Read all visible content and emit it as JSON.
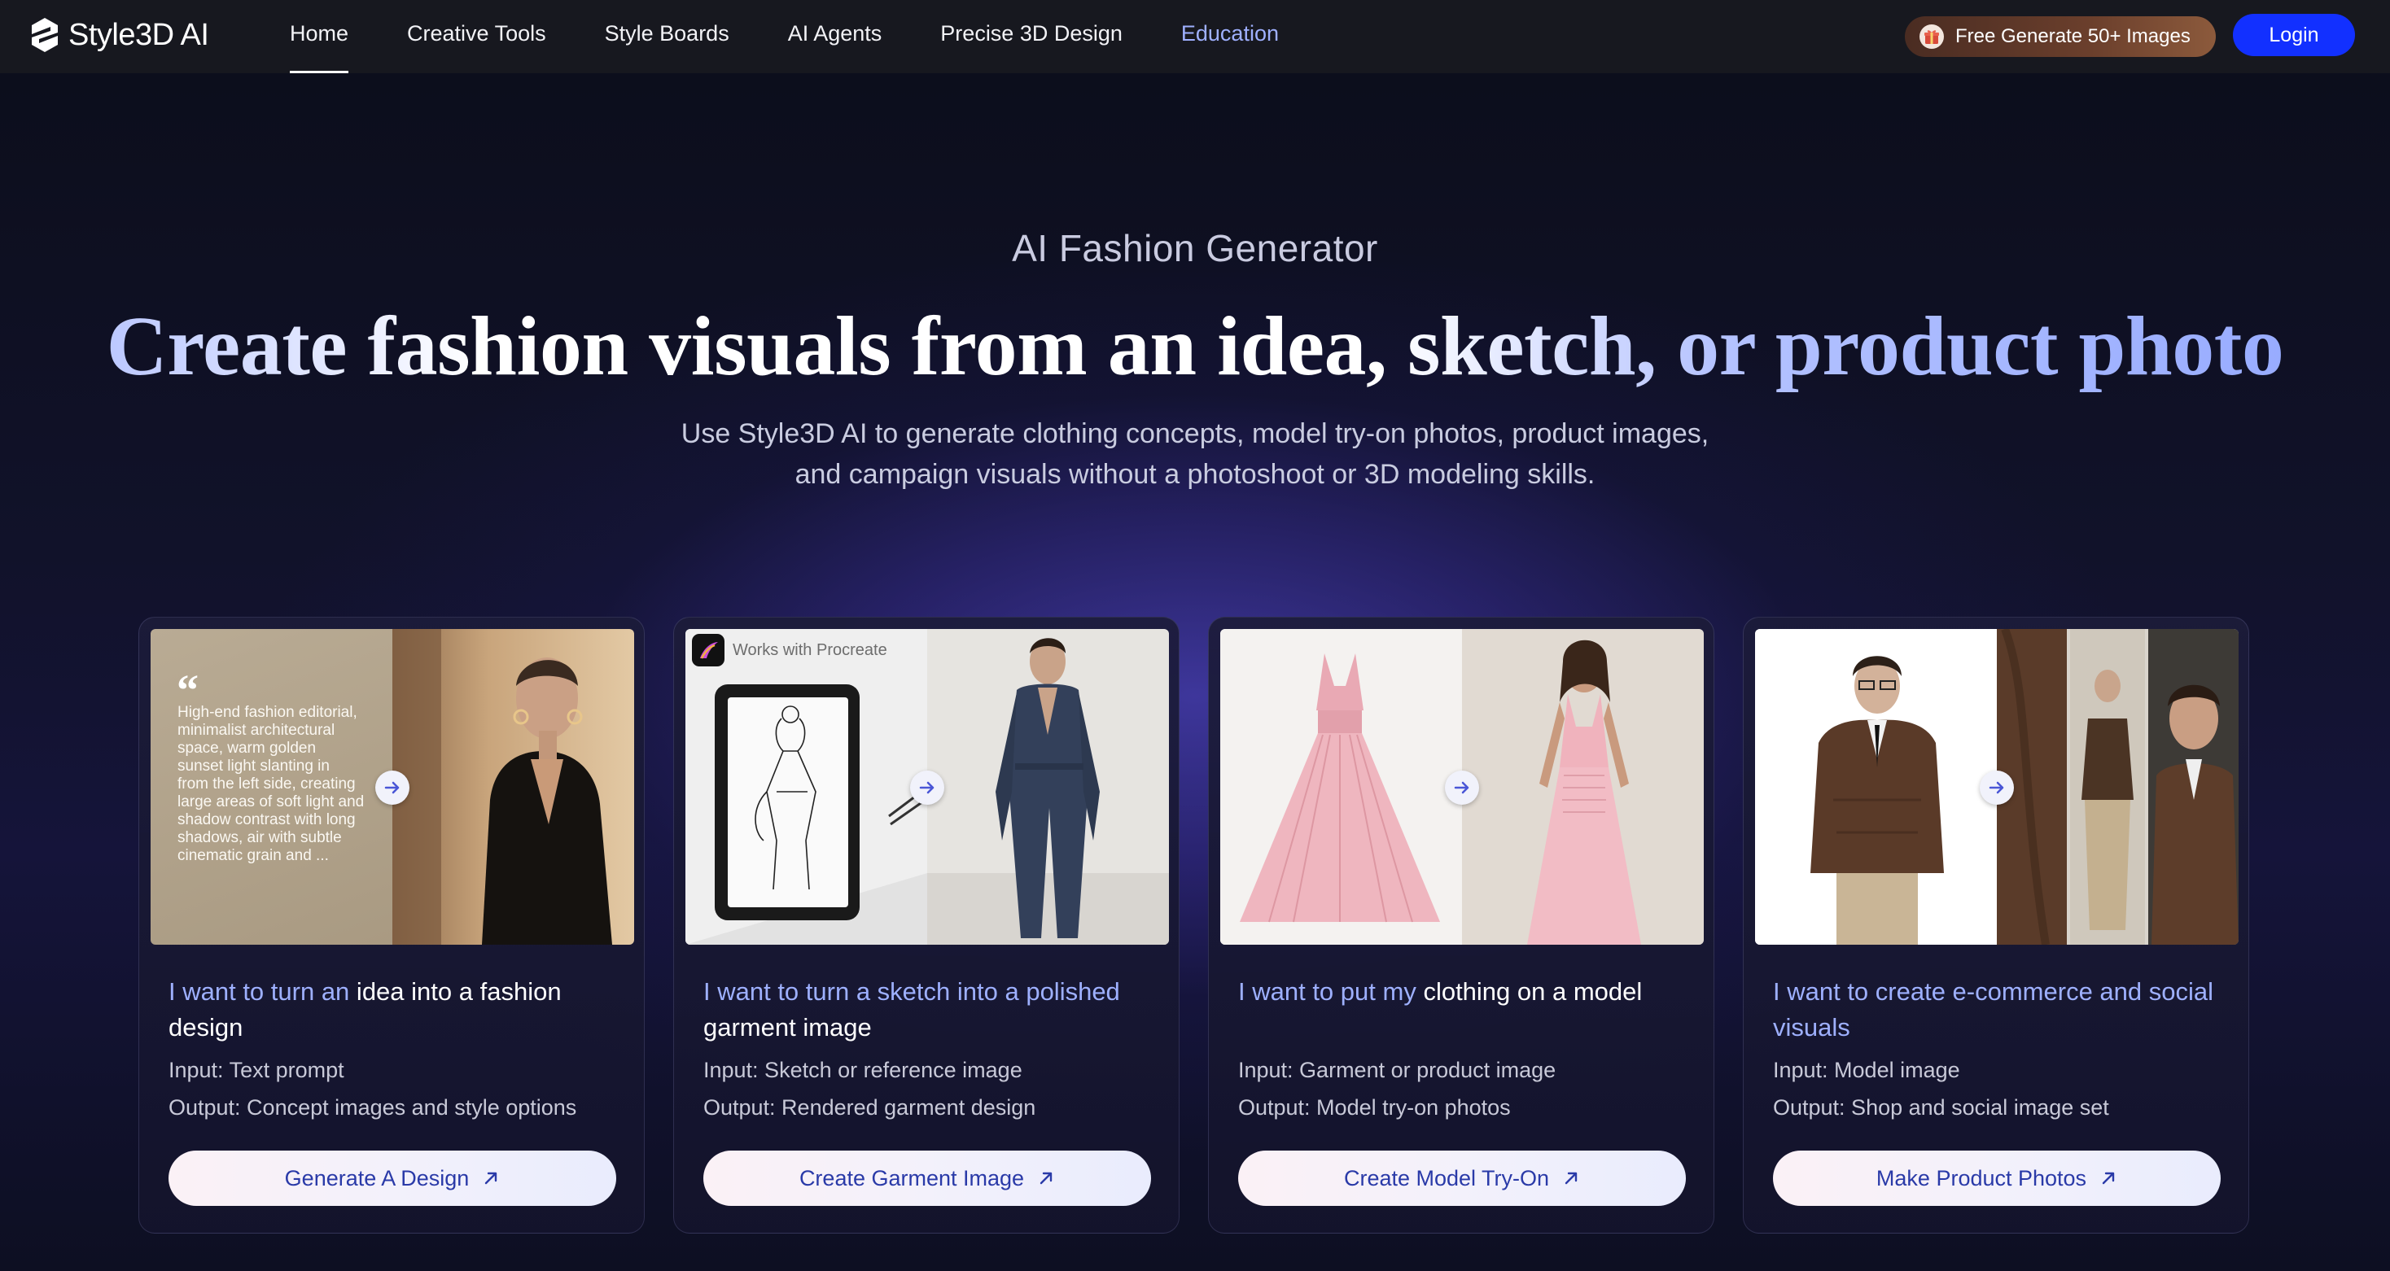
{
  "nav": {
    "brand": "Style3D AI",
    "items": [
      {
        "label": "Home"
      },
      {
        "label": "Creative Tools"
      },
      {
        "label": "Style Boards"
      },
      {
        "label": "AI Agents"
      },
      {
        "label": "Precise 3D Design"
      },
      {
        "label": "Education"
      }
    ],
    "promo": "Free Generate 50+ Images",
    "login": "Login"
  },
  "hero": {
    "eyebrow": "AI Fashion Generator",
    "headline": "Create fashion visuals from an idea, sketch, or product photo",
    "subtitle_line1": "Use Style3D AI to generate clothing concepts, model try-on photos, product images,",
    "subtitle_line2": "and campaign visuals without a photoshoot or 3D modeling skills."
  },
  "cards": [
    {
      "title_highlight": "I want to turn an",
      "title_rest": " idea into a fashion design",
      "input": "Input: Text prompt",
      "output": "Output: Concept images and style options",
      "button": "Generate A Design",
      "quote": "High-end fashion editorial, minimalist architectural space, warm golden sunset light slanting in from the left side, creating large areas of soft light and shadow contrast with long shadows, air with subtle cinematic grain and ..."
    },
    {
      "title_highlight": "I want to turn a sketch into a polished",
      "title_rest": " garment image",
      "input": "Input: Sketch or reference image",
      "output": "Output: Rendered garment design",
      "button": "Create Garment Image",
      "badge": "Works with Procreate"
    },
    {
      "title_highlight": "I want to put my",
      "title_rest": " clothing on a model",
      "input": "Input: Garment or product image",
      "output": "Output: Model try-on photos",
      "button": "Create Model Try-On"
    },
    {
      "title_highlight": "I want to create e-commerce and social visuals",
      "title_rest": "",
      "input": "Input: Model image",
      "output": "Output: Shop and social image set",
      "button": "Make Product Photos"
    }
  ],
  "colors": {
    "accent": "#1230ff",
    "highlight": "#9eb0ff",
    "nav_bg": "#17181f"
  }
}
